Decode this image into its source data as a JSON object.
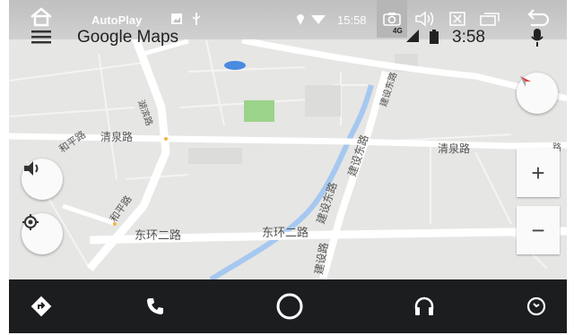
{
  "status_bar": {
    "app_name": "AutoPlay",
    "time": "15:58",
    "network_label": "4G",
    "icons": [
      "home-icon",
      "image-icon",
      "usb-icon",
      "location-icon",
      "wifi-icon",
      "camera-icon",
      "volume-icon",
      "close-box-icon",
      "windows-icon",
      "back-icon"
    ]
  },
  "header": {
    "title": "Google Maps",
    "time": "3:58",
    "icons": [
      "menu-icon",
      "signal-icon",
      "battery-icon",
      "microphone-icon"
    ]
  },
  "map": {
    "road_labels": {
      "qingquan_left": "清泉路",
      "qingquan_right": "清泉路",
      "donghuan_left": "东环二路",
      "donghuan_mid": "东环二路",
      "jianshe_east_a": "建设东路",
      "jianshe_east_b": "建设东路",
      "jianshe_lower": "建设路",
      "heping_a": "和平路",
      "heping_b": "和平路",
      "left_top_road": "湖滨路",
      "right_edge": "路"
    },
    "colors": {
      "road": "#ffffff",
      "river": "#a6c8f0",
      "park": "#9bd38a",
      "land": "#e6e6e4"
    }
  },
  "controls": {
    "compass_icon": "compass-icon",
    "volume_icon": "speaker-icon",
    "recenter_icon": "my-location-icon",
    "zoom_in": "+",
    "zoom_out": "−"
  },
  "nav_bar": {
    "icons": [
      "navigation-icon",
      "phone-icon",
      "home-circle-icon",
      "headphones-icon",
      "notification-icon"
    ]
  }
}
